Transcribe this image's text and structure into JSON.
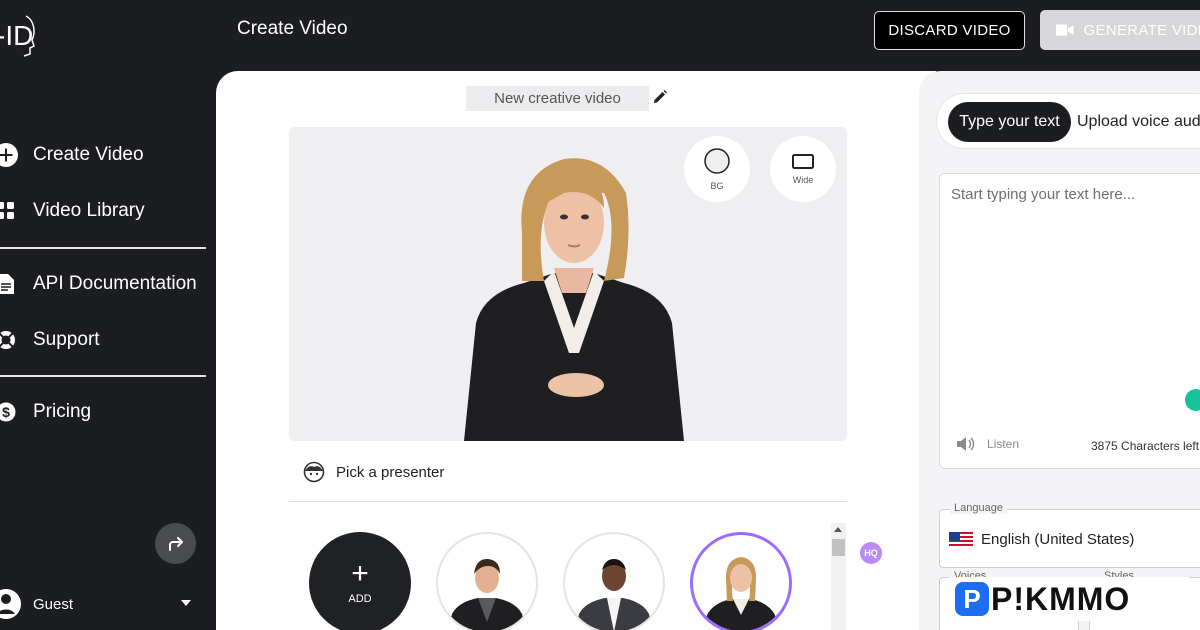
{
  "sidebar": {
    "logo": "ID",
    "items": [
      {
        "label": "Create Video",
        "icon": "plus-circle-icon"
      },
      {
        "label": "Video Library",
        "icon": "grid-icon"
      },
      {
        "label": "API Documentation",
        "icon": "document-icon"
      },
      {
        "label": "Support",
        "icon": "lifebuoy-icon"
      },
      {
        "label": "Pricing",
        "icon": "dollar-icon"
      }
    ],
    "user": {
      "name": "Guest"
    }
  },
  "header": {
    "title": "Create Video",
    "discard_label": "DISCARD VIDEO",
    "generate_label": "GENERATE VIDEO"
  },
  "editor": {
    "video_name": "New creative video",
    "bg_label": "BG",
    "wide_label": "Wide",
    "pick_presenter_label": "Pick a presenter",
    "add_label": "ADD",
    "hq_badge": "HQ"
  },
  "script": {
    "tabs": [
      "Type your text",
      "Upload voice audio"
    ],
    "placeholder": "Start typing your text here...",
    "listen_label": "Listen",
    "char_count": "3875 Characters left",
    "language_label": "Language",
    "language_value": "English (United States)",
    "voices_label": "Voices",
    "styles_label": "Styles"
  },
  "watermark": "P!KMMO",
  "colors": {
    "sidebar_bg": "#1c1d20",
    "selected_ring": "#9c6bff",
    "hq_badge": "#b98cf5"
  }
}
